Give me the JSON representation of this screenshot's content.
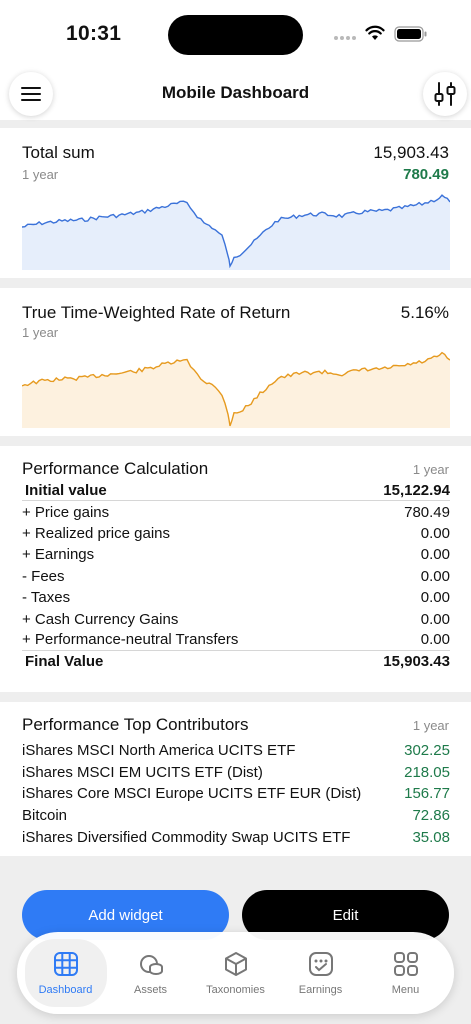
{
  "status_bar": {
    "time": "10:31"
  },
  "header": {
    "title": "Mobile Dashboard"
  },
  "total_sum": {
    "title": "Total sum",
    "period": "1 year",
    "value": "15,903.43",
    "gain": "780.49",
    "line_color": "#3b72d9",
    "fill_color": "#e6eefb"
  },
  "ttwror": {
    "title": "True Time-Weighted Rate of Return",
    "period": "1 year",
    "value": "5.16%",
    "line_color": "#e69a1f",
    "fill_color": "#fdf1df"
  },
  "performance": {
    "title": "Performance Calculation",
    "period": "1 year",
    "rows": [
      {
        "label": "Initial value",
        "value": "15,122.94"
      },
      {
        "label": "+ Price gains",
        "value": "780.49"
      },
      {
        "label": "+ Realized price gains",
        "value": "0.00"
      },
      {
        "label": "+ Earnings",
        "value": "0.00"
      },
      {
        "label": "- Fees",
        "value": "0.00"
      },
      {
        "label": "- Taxes",
        "value": "0.00"
      },
      {
        "label": "+ Cash Currency Gains",
        "value": "0.00"
      },
      {
        "label": "+ Performance-neutral Transfers",
        "value": "0.00"
      },
      {
        "label": "Final Value",
        "value": "15,903.43"
      }
    ]
  },
  "contributors": {
    "title": "Performance Top Contributors",
    "period": "1 year",
    "items": [
      {
        "name": "iShares MSCI North America UCITS ETF",
        "value": "302.25"
      },
      {
        "name": "iShares MSCI EM UCITS ETF (Dist)",
        "value": "218.05"
      },
      {
        "name": "iShares Core MSCI Europe UCITS ETF EUR (Dist)",
        "value": "156.77"
      },
      {
        "name": "Bitcoin",
        "value": "72.86"
      },
      {
        "name": "iShares Diversified Commodity Swap UCITS ETF",
        "value": "35.08"
      }
    ]
  },
  "actions": {
    "add_widget": "Add widget",
    "edit": "Edit"
  },
  "tabs": [
    {
      "label": "Dashboard",
      "icon": "grid-icon",
      "active": true
    },
    {
      "label": "Assets",
      "icon": "coins-icon",
      "active": false
    },
    {
      "label": "Taxonomies",
      "icon": "cube-icon",
      "active": false
    },
    {
      "label": "Earnings",
      "icon": "earnings-icon",
      "active": false
    },
    {
      "label": "Menu",
      "icon": "menu-grid-icon",
      "active": false
    }
  ],
  "colors": {
    "accent": "#2f7bf5",
    "positive": "#1e7a4a"
  }
}
